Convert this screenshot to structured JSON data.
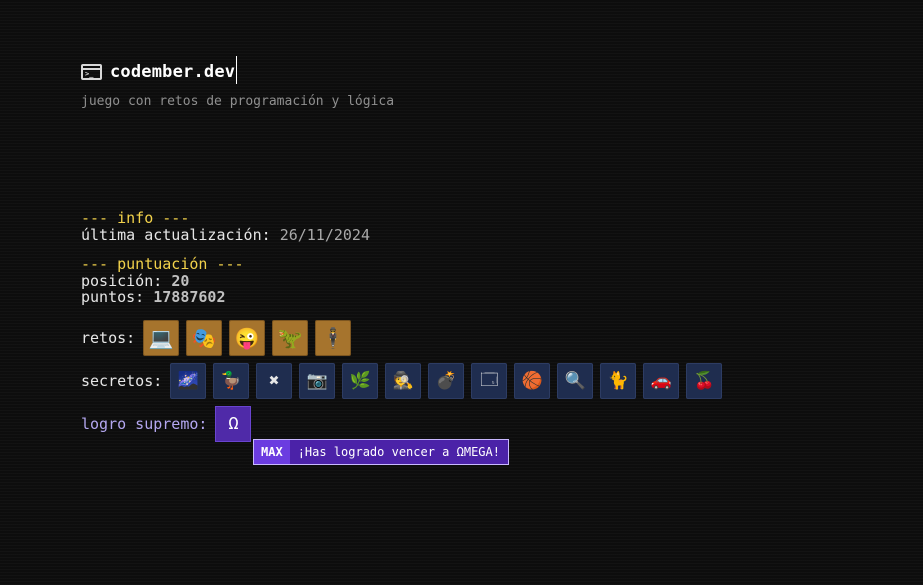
{
  "header": {
    "title": "codember.dev",
    "subtitle": "juego con retos de programación y lógica",
    "icon": "terminal-icon"
  },
  "info": {
    "heading": "--- info ---",
    "updated_label": "última actualización:",
    "updated_value": "26/11/2024"
  },
  "score": {
    "heading": "--- puntuación ---",
    "position_label": "posición:",
    "position_value": "20",
    "points_label": "puntos:",
    "points_value": "17887602"
  },
  "retos": {
    "label": "retos:",
    "items": [
      {
        "icon": "computer-icon",
        "glyph": "💻"
      },
      {
        "icon": "mask-icon",
        "glyph": "🎭"
      },
      {
        "icon": "smiley-icon",
        "glyph": "😜"
      },
      {
        "icon": "dinosaur-icon",
        "glyph": "🦖"
      },
      {
        "icon": "agent-icon",
        "glyph": "🕴"
      }
    ]
  },
  "secretos": {
    "label": "secretos:",
    "items": [
      {
        "icon": "galaxy-icon",
        "glyph": "🌌"
      },
      {
        "icon": "duck-icon",
        "glyph": "🦆"
      },
      {
        "icon": "x-icon",
        "glyph": "✖"
      },
      {
        "icon": "camera-icon",
        "glyph": "📷"
      },
      {
        "icon": "plant-icon",
        "glyph": "🌿"
      },
      {
        "icon": "hacker-icon",
        "glyph": "🕵"
      },
      {
        "icon": "bomb-icon",
        "glyph": "💣"
      },
      {
        "icon": "window-icon",
        "glyph": "🗔"
      },
      {
        "icon": "ball-icon",
        "glyph": "🏀"
      },
      {
        "icon": "magnifier-icon",
        "glyph": "🔍"
      },
      {
        "icon": "cat-icon",
        "glyph": "🐈"
      },
      {
        "icon": "car-icon",
        "glyph": "🚗"
      },
      {
        "icon": "cherry-icon",
        "glyph": "🍒"
      }
    ]
  },
  "logro": {
    "label": "logro supremo:",
    "badge": "Ω",
    "tooltip_tag": "MAX",
    "tooltip_text": "¡Has logrado vencer a ΩMEGA!"
  }
}
